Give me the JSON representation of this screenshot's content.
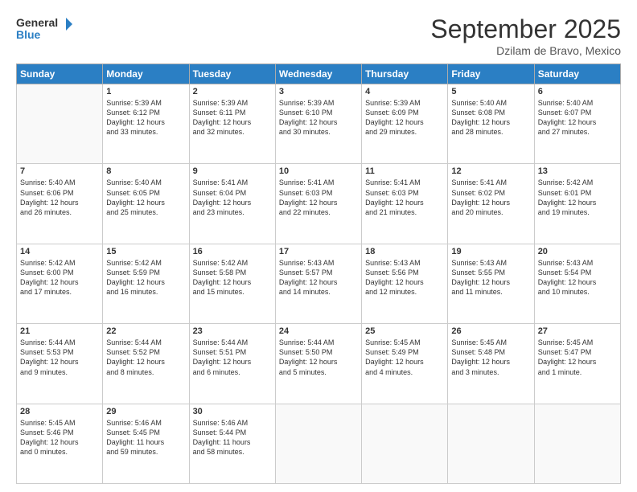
{
  "header": {
    "logo_line1": "General",
    "logo_line2": "Blue",
    "month": "September 2025",
    "location": "Dzilam de Bravo, Mexico"
  },
  "weekdays": [
    "Sunday",
    "Monday",
    "Tuesday",
    "Wednesday",
    "Thursday",
    "Friday",
    "Saturday"
  ],
  "weeks": [
    [
      {
        "day": "",
        "info": ""
      },
      {
        "day": "1",
        "info": "Sunrise: 5:39 AM\nSunset: 6:12 PM\nDaylight: 12 hours\nand 33 minutes."
      },
      {
        "day": "2",
        "info": "Sunrise: 5:39 AM\nSunset: 6:11 PM\nDaylight: 12 hours\nand 32 minutes."
      },
      {
        "day": "3",
        "info": "Sunrise: 5:39 AM\nSunset: 6:10 PM\nDaylight: 12 hours\nand 30 minutes."
      },
      {
        "day": "4",
        "info": "Sunrise: 5:39 AM\nSunset: 6:09 PM\nDaylight: 12 hours\nand 29 minutes."
      },
      {
        "day": "5",
        "info": "Sunrise: 5:40 AM\nSunset: 6:08 PM\nDaylight: 12 hours\nand 28 minutes."
      },
      {
        "day": "6",
        "info": "Sunrise: 5:40 AM\nSunset: 6:07 PM\nDaylight: 12 hours\nand 27 minutes."
      }
    ],
    [
      {
        "day": "7",
        "info": "Sunrise: 5:40 AM\nSunset: 6:06 PM\nDaylight: 12 hours\nand 26 minutes."
      },
      {
        "day": "8",
        "info": "Sunrise: 5:40 AM\nSunset: 6:05 PM\nDaylight: 12 hours\nand 25 minutes."
      },
      {
        "day": "9",
        "info": "Sunrise: 5:41 AM\nSunset: 6:04 PM\nDaylight: 12 hours\nand 23 minutes."
      },
      {
        "day": "10",
        "info": "Sunrise: 5:41 AM\nSunset: 6:03 PM\nDaylight: 12 hours\nand 22 minutes."
      },
      {
        "day": "11",
        "info": "Sunrise: 5:41 AM\nSunset: 6:03 PM\nDaylight: 12 hours\nand 21 minutes."
      },
      {
        "day": "12",
        "info": "Sunrise: 5:41 AM\nSunset: 6:02 PM\nDaylight: 12 hours\nand 20 minutes."
      },
      {
        "day": "13",
        "info": "Sunrise: 5:42 AM\nSunset: 6:01 PM\nDaylight: 12 hours\nand 19 minutes."
      }
    ],
    [
      {
        "day": "14",
        "info": "Sunrise: 5:42 AM\nSunset: 6:00 PM\nDaylight: 12 hours\nand 17 minutes."
      },
      {
        "day": "15",
        "info": "Sunrise: 5:42 AM\nSunset: 5:59 PM\nDaylight: 12 hours\nand 16 minutes."
      },
      {
        "day": "16",
        "info": "Sunrise: 5:42 AM\nSunset: 5:58 PM\nDaylight: 12 hours\nand 15 minutes."
      },
      {
        "day": "17",
        "info": "Sunrise: 5:43 AM\nSunset: 5:57 PM\nDaylight: 12 hours\nand 14 minutes."
      },
      {
        "day": "18",
        "info": "Sunrise: 5:43 AM\nSunset: 5:56 PM\nDaylight: 12 hours\nand 12 minutes."
      },
      {
        "day": "19",
        "info": "Sunrise: 5:43 AM\nSunset: 5:55 PM\nDaylight: 12 hours\nand 11 minutes."
      },
      {
        "day": "20",
        "info": "Sunrise: 5:43 AM\nSunset: 5:54 PM\nDaylight: 12 hours\nand 10 minutes."
      }
    ],
    [
      {
        "day": "21",
        "info": "Sunrise: 5:44 AM\nSunset: 5:53 PM\nDaylight: 12 hours\nand 9 minutes."
      },
      {
        "day": "22",
        "info": "Sunrise: 5:44 AM\nSunset: 5:52 PM\nDaylight: 12 hours\nand 8 minutes."
      },
      {
        "day": "23",
        "info": "Sunrise: 5:44 AM\nSunset: 5:51 PM\nDaylight: 12 hours\nand 6 minutes."
      },
      {
        "day": "24",
        "info": "Sunrise: 5:44 AM\nSunset: 5:50 PM\nDaylight: 12 hours\nand 5 minutes."
      },
      {
        "day": "25",
        "info": "Sunrise: 5:45 AM\nSunset: 5:49 PM\nDaylight: 12 hours\nand 4 minutes."
      },
      {
        "day": "26",
        "info": "Sunrise: 5:45 AM\nSunset: 5:48 PM\nDaylight: 12 hours\nand 3 minutes."
      },
      {
        "day": "27",
        "info": "Sunrise: 5:45 AM\nSunset: 5:47 PM\nDaylight: 12 hours\nand 1 minute."
      }
    ],
    [
      {
        "day": "28",
        "info": "Sunrise: 5:45 AM\nSunset: 5:46 PM\nDaylight: 12 hours\nand 0 minutes."
      },
      {
        "day": "29",
        "info": "Sunrise: 5:46 AM\nSunset: 5:45 PM\nDaylight: 11 hours\nand 59 minutes."
      },
      {
        "day": "30",
        "info": "Sunrise: 5:46 AM\nSunset: 5:44 PM\nDaylight: 11 hours\nand 58 minutes."
      },
      {
        "day": "",
        "info": ""
      },
      {
        "day": "",
        "info": ""
      },
      {
        "day": "",
        "info": ""
      },
      {
        "day": "",
        "info": ""
      }
    ]
  ]
}
